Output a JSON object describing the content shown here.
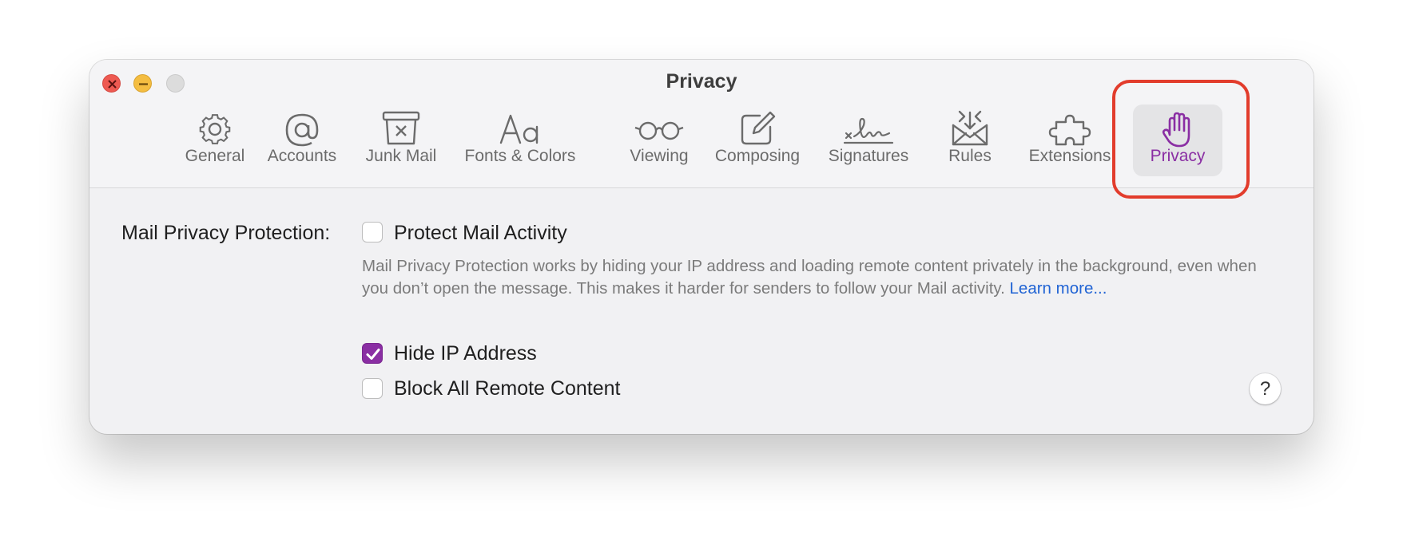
{
  "window": {
    "title": "Privacy"
  },
  "toolbar": {
    "tabs": [
      {
        "label": "General",
        "icon": "gear-icon"
      },
      {
        "label": "Accounts",
        "icon": "at-sign-icon"
      },
      {
        "label": "Junk Mail",
        "icon": "junk-box-icon"
      },
      {
        "label": "Fonts & Colors",
        "icon": "fonts-aa-icon"
      },
      {
        "label": "Viewing",
        "icon": "glasses-icon"
      },
      {
        "label": "Composing",
        "icon": "compose-icon"
      },
      {
        "label": "Signatures",
        "icon": "signature-icon"
      },
      {
        "label": "Rules",
        "icon": "rules-envelope-icon"
      },
      {
        "label": "Extensions",
        "icon": "puzzle-piece-icon"
      },
      {
        "label": "Privacy",
        "icon": "hand-icon"
      }
    ],
    "active_tab": "Privacy"
  },
  "privacy": {
    "section_label": "Mail Privacy Protection:",
    "protect_mail_activity": {
      "label": "Protect Mail Activity",
      "checked": false
    },
    "description": "Mail Privacy Protection works by hiding your IP address and loading remote content privately in the background, even when you don’t open the message. This makes it harder for senders to follow your Mail activity.",
    "learn_more": "Learn more...",
    "hide_ip_address": {
      "label": "Hide IP Address",
      "checked": true
    },
    "block_remote_content": {
      "label": "Block All Remote Content",
      "checked": false
    },
    "help_label": "?"
  },
  "colors": {
    "accent": "#8a2ea3",
    "highlight": "#e23c2c",
    "link": "#2164d4"
  }
}
